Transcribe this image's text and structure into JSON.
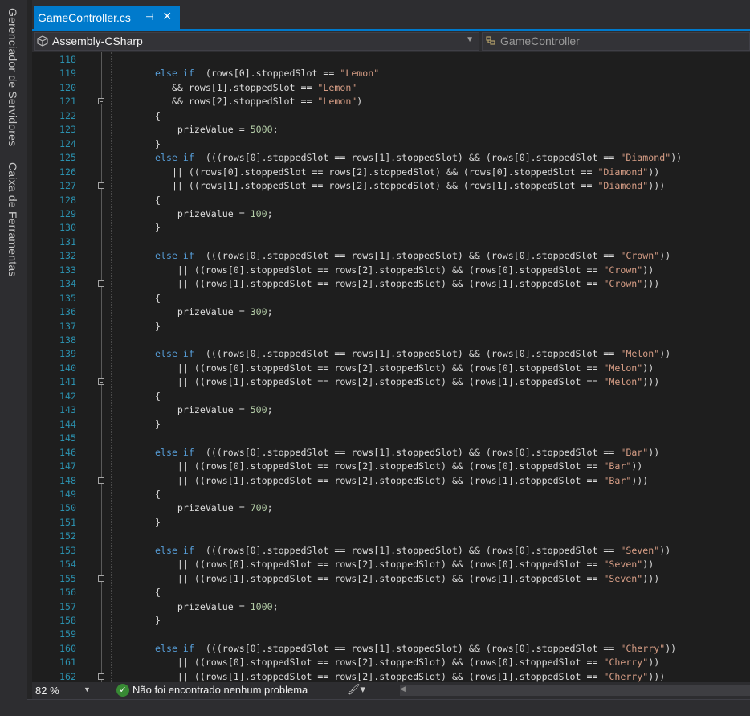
{
  "sidebar": {
    "tabs": [
      "Gerenciador de Servidores",
      "Caixa de Ferramentas"
    ]
  },
  "tab": {
    "filename": "GameController.cs",
    "pin_glyph": "⊣",
    "close_glyph": "×"
  },
  "navbar": {
    "project": "Assembly-CSharp",
    "class": "GameController"
  },
  "colors": {
    "accent": "#007acc",
    "keyword": "#569cd6",
    "string": "#d69d85",
    "number": "#b5cea8",
    "line_number": "#2b91af",
    "text": "#dcdcdc",
    "ok": "#388a34"
  },
  "code": [
    {
      "n": "118",
      "fold": false,
      "tokens": []
    },
    {
      "n": "119",
      "fold": false,
      "tokens": [
        [
          "kw",
          "else if"
        ],
        [
          "",
          "  (rows[0].stoppedSlot == "
        ],
        [
          "str",
          "\"Lemon\""
        ]
      ]
    },
    {
      "n": "120",
      "fold": false,
      "tokens": [
        [
          "",
          "   && rows[1].stoppedSlot == "
        ],
        [
          "str",
          "\"Lemon\""
        ]
      ]
    },
    {
      "n": "121",
      "fold": true,
      "tokens": [
        [
          "",
          "   && rows[2].stoppedSlot == "
        ],
        [
          "str",
          "\"Lemon\""
        ],
        [
          "",
          ")"
        ]
      ]
    },
    {
      "n": "122",
      "fold": false,
      "tokens": [
        [
          "",
          "{"
        ]
      ]
    },
    {
      "n": "123",
      "fold": false,
      "tokens": [
        [
          "",
          "    prizeValue = "
        ],
        [
          "num",
          "5000"
        ],
        [
          "",
          ";"
        ]
      ]
    },
    {
      "n": "124",
      "fold": false,
      "tokens": [
        [
          "",
          "}"
        ]
      ]
    },
    {
      "n": "125",
      "fold": false,
      "tokens": [
        [
          "kw",
          "else if"
        ],
        [
          "",
          "  (((rows[0].stoppedSlot == rows[1].stoppedSlot) && (rows[0].stoppedSlot == "
        ],
        [
          "str",
          "\"Diamond\""
        ],
        [
          "",
          "))"
        ]
      ]
    },
    {
      "n": "126",
      "fold": false,
      "tokens": [
        [
          "",
          "   || ((rows[0].stoppedSlot == rows[2].stoppedSlot) && (rows[0].stoppedSlot == "
        ],
        [
          "str",
          "\"Diamond\""
        ],
        [
          "",
          "))"
        ]
      ]
    },
    {
      "n": "127",
      "fold": true,
      "tokens": [
        [
          "",
          "   || ((rows[1].stoppedSlot == rows[2].stoppedSlot) && (rows[1].stoppedSlot == "
        ],
        [
          "str",
          "\"Diamond\""
        ],
        [
          "",
          ")))"
        ]
      ]
    },
    {
      "n": "128",
      "fold": false,
      "tokens": [
        [
          "",
          "{"
        ]
      ]
    },
    {
      "n": "129",
      "fold": false,
      "tokens": [
        [
          "",
          "    prizeValue = "
        ],
        [
          "num",
          "100"
        ],
        [
          "",
          ";"
        ]
      ]
    },
    {
      "n": "130",
      "fold": false,
      "tokens": [
        [
          "",
          "}"
        ]
      ]
    },
    {
      "n": "131",
      "fold": false,
      "tokens": []
    },
    {
      "n": "132",
      "fold": false,
      "tokens": [
        [
          "kw",
          "else if"
        ],
        [
          "",
          "  (((rows[0].stoppedSlot == rows[1].stoppedSlot) && (rows[0].stoppedSlot == "
        ],
        [
          "str",
          "\"Crown\""
        ],
        [
          "",
          "))"
        ]
      ]
    },
    {
      "n": "133",
      "fold": false,
      "tokens": [
        [
          "",
          "    || ((rows[0].stoppedSlot == rows[2].stoppedSlot) && (rows[0].stoppedSlot == "
        ],
        [
          "str",
          "\"Crown\""
        ],
        [
          "",
          "))"
        ]
      ]
    },
    {
      "n": "134",
      "fold": true,
      "tokens": [
        [
          "",
          "    || ((rows[1].stoppedSlot == rows[2].stoppedSlot) && (rows[1].stoppedSlot == "
        ],
        [
          "str",
          "\"Crown\""
        ],
        [
          "",
          ")))"
        ]
      ]
    },
    {
      "n": "135",
      "fold": false,
      "tokens": [
        [
          "",
          "{"
        ]
      ]
    },
    {
      "n": "136",
      "fold": false,
      "tokens": [
        [
          "",
          "    prizeValue = "
        ],
        [
          "num",
          "300"
        ],
        [
          "",
          ";"
        ]
      ]
    },
    {
      "n": "137",
      "fold": false,
      "tokens": [
        [
          "",
          "}"
        ]
      ]
    },
    {
      "n": "138",
      "fold": false,
      "tokens": []
    },
    {
      "n": "139",
      "fold": false,
      "tokens": [
        [
          "kw",
          "else if"
        ],
        [
          "",
          "  (((rows[0].stoppedSlot == rows[1].stoppedSlot) && (rows[0].stoppedSlot == "
        ],
        [
          "str",
          "\"Melon\""
        ],
        [
          "",
          "))"
        ]
      ]
    },
    {
      "n": "140",
      "fold": false,
      "tokens": [
        [
          "",
          "    || ((rows[0].stoppedSlot == rows[2].stoppedSlot) && (rows[0].stoppedSlot == "
        ],
        [
          "str",
          "\"Melon\""
        ],
        [
          "",
          "))"
        ]
      ]
    },
    {
      "n": "141",
      "fold": true,
      "tokens": [
        [
          "",
          "    || ((rows[1].stoppedSlot == rows[2].stoppedSlot) && (rows[1].stoppedSlot == "
        ],
        [
          "str",
          "\"Melon\""
        ],
        [
          "",
          ")))"
        ]
      ]
    },
    {
      "n": "142",
      "fold": false,
      "tokens": [
        [
          "",
          "{"
        ]
      ]
    },
    {
      "n": "143",
      "fold": false,
      "tokens": [
        [
          "",
          "    prizeValue = "
        ],
        [
          "num",
          "500"
        ],
        [
          "",
          ";"
        ]
      ]
    },
    {
      "n": "144",
      "fold": false,
      "tokens": [
        [
          "",
          "}"
        ]
      ]
    },
    {
      "n": "145",
      "fold": false,
      "tokens": []
    },
    {
      "n": "146",
      "fold": false,
      "tokens": [
        [
          "kw",
          "else if"
        ],
        [
          "",
          "  (((rows[0].stoppedSlot == rows[1].stoppedSlot) && (rows[0].stoppedSlot == "
        ],
        [
          "str",
          "\"Bar\""
        ],
        [
          "",
          "))"
        ]
      ]
    },
    {
      "n": "147",
      "fold": false,
      "tokens": [
        [
          "",
          "    || ((rows[0].stoppedSlot == rows[2].stoppedSlot) && (rows[0].stoppedSlot == "
        ],
        [
          "str",
          "\"Bar\""
        ],
        [
          "",
          "))"
        ]
      ]
    },
    {
      "n": "148",
      "fold": true,
      "tokens": [
        [
          "",
          "    || ((rows[1].stoppedSlot == rows[2].stoppedSlot) && (rows[1].stoppedSlot == "
        ],
        [
          "str",
          "\"Bar\""
        ],
        [
          "",
          ")))"
        ]
      ]
    },
    {
      "n": "149",
      "fold": false,
      "tokens": [
        [
          "",
          "{"
        ]
      ]
    },
    {
      "n": "150",
      "fold": false,
      "tokens": [
        [
          "",
          "    prizeValue = "
        ],
        [
          "num",
          "700"
        ],
        [
          "",
          ";"
        ]
      ]
    },
    {
      "n": "151",
      "fold": false,
      "tokens": [
        [
          "",
          "}"
        ]
      ]
    },
    {
      "n": "152",
      "fold": false,
      "tokens": []
    },
    {
      "n": "153",
      "fold": false,
      "tokens": [
        [
          "kw",
          "else if"
        ],
        [
          "",
          "  (((rows[0].stoppedSlot == rows[1].stoppedSlot) && (rows[0].stoppedSlot == "
        ],
        [
          "str",
          "\"Seven\""
        ],
        [
          "",
          "))"
        ]
      ]
    },
    {
      "n": "154",
      "fold": false,
      "tokens": [
        [
          "",
          "    || ((rows[0].stoppedSlot == rows[2].stoppedSlot) && (rows[0].stoppedSlot == "
        ],
        [
          "str",
          "\"Seven\""
        ],
        [
          "",
          "))"
        ]
      ]
    },
    {
      "n": "155",
      "fold": true,
      "tokens": [
        [
          "",
          "    || ((rows[1].stoppedSlot == rows[2].stoppedSlot) && (rows[1].stoppedSlot == "
        ],
        [
          "str",
          "\"Seven\""
        ],
        [
          "",
          ")))"
        ]
      ]
    },
    {
      "n": "156",
      "fold": false,
      "tokens": [
        [
          "",
          "{"
        ]
      ]
    },
    {
      "n": "157",
      "fold": false,
      "tokens": [
        [
          "",
          "    prizeValue = "
        ],
        [
          "num",
          "1000"
        ],
        [
          "",
          ";"
        ]
      ]
    },
    {
      "n": "158",
      "fold": false,
      "tokens": [
        [
          "",
          "}"
        ]
      ]
    },
    {
      "n": "159",
      "fold": false,
      "tokens": []
    },
    {
      "n": "160",
      "fold": false,
      "tokens": [
        [
          "kw",
          "else if"
        ],
        [
          "",
          "  (((rows[0].stoppedSlot == rows[1].stoppedSlot) && (rows[0].stoppedSlot == "
        ],
        [
          "str",
          "\"Cherry\""
        ],
        [
          "",
          "))"
        ]
      ]
    },
    {
      "n": "161",
      "fold": false,
      "tokens": [
        [
          "",
          "    || ((rows[0].stoppedSlot == rows[2].stoppedSlot) && (rows[0].stoppedSlot == "
        ],
        [
          "str",
          "\"Cherry\""
        ],
        [
          "",
          "))"
        ]
      ]
    },
    {
      "n": "162",
      "fold": true,
      "tokens": [
        [
          "",
          "    || ((rows[1].stoppedSlot == rows[2].stoppedSlot) && (rows[1].stoppedSlot == "
        ],
        [
          "str",
          "\"Cherry\""
        ],
        [
          "",
          ")))"
        ]
      ]
    }
  ],
  "status": {
    "zoom": "82 %",
    "message": "Não foi encontrado nenhum problema"
  }
}
